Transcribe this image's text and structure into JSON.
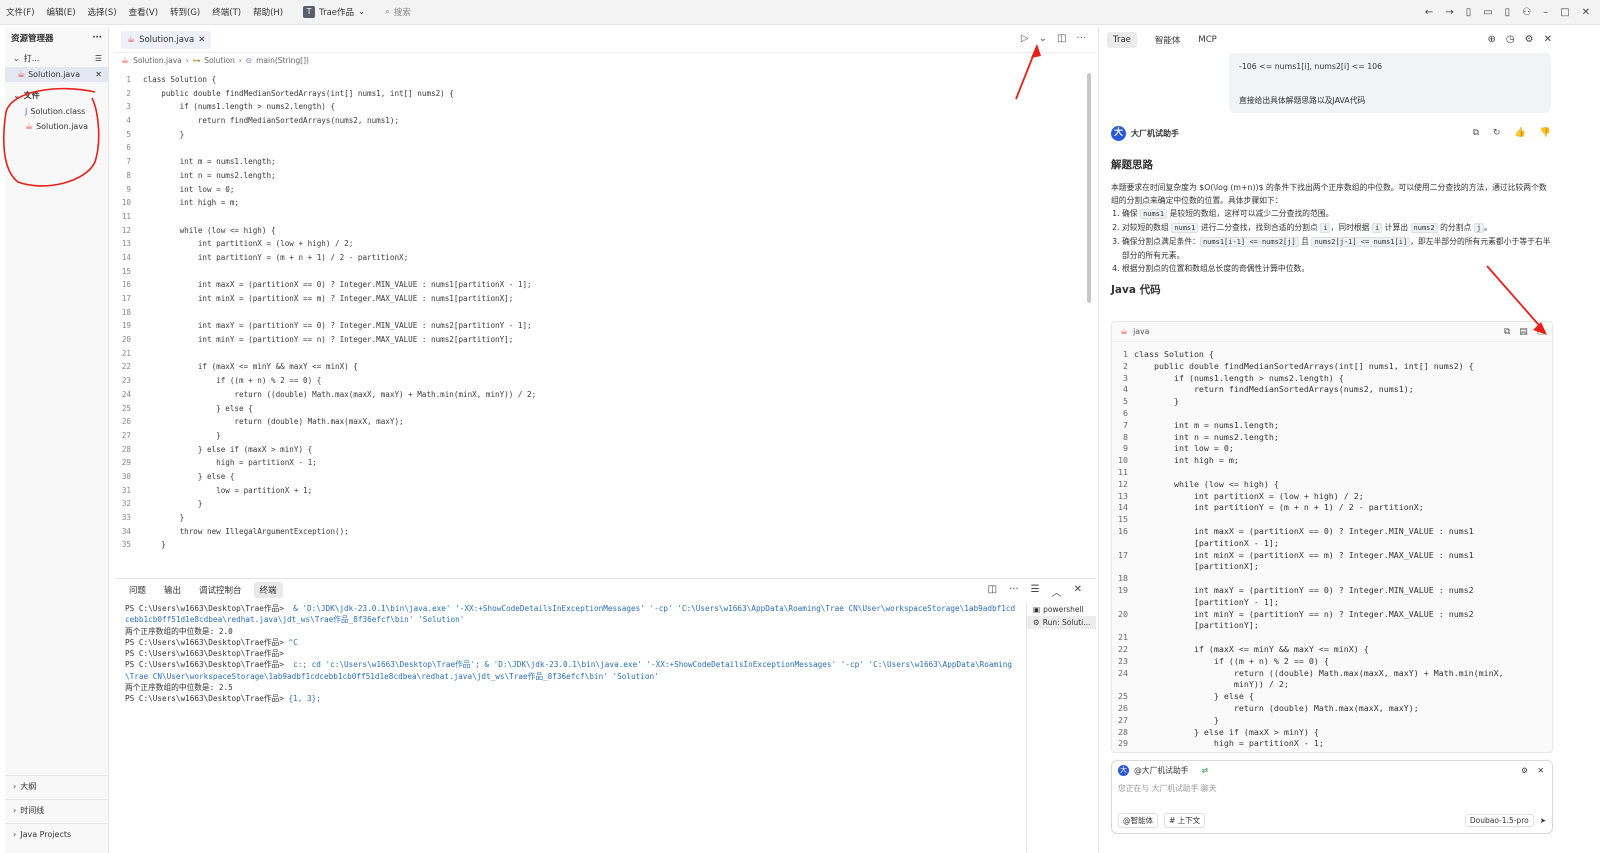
{
  "menubar": {
    "items": [
      "文件(F)",
      "编辑(E)",
      "选择(S)",
      "查看(V)",
      "转到(G)",
      "终端(T)",
      "帮助(H)"
    ],
    "project_icon": "T",
    "project": "Trae作品",
    "search": "搜索"
  },
  "explorer": {
    "title": "资源管理器",
    "open_section": "打...",
    "open_file": "Solution.java",
    "files_section": "文件",
    "files": [
      "Solution.class",
      "Solution.java"
    ],
    "outline": "大纲",
    "timeline": "时间线",
    "java_projects": "Java Projects"
  },
  "editor": {
    "tab": "Solution.java",
    "breadcrumb": [
      "Solution.java",
      "Solution",
      "main(String[])"
    ],
    "lines": [
      "class Solution {",
      "    public double findMedianSortedArrays(int[] nums1, int[] nums2) {",
      "        if (nums1.length > nums2.length) {",
      "            return findMedianSortedArrays(nums2, nums1);",
      "        }",
      "",
      "        int m = nums1.length;",
      "        int n = nums2.length;",
      "        int low = 0;",
      "        int high = m;",
      "",
      "        while (low <= high) {",
      "            int partitionX = (low + high) / 2;",
      "            int partitionY = (m + n + 1) / 2 - partitionX;",
      "",
      "            int maxX = (partitionX == 0) ? Integer.MIN_VALUE : nums1[partitionX - 1];",
      "            int minX = (partitionX == m) ? Integer.MAX_VALUE : nums1[partitionX];",
      "",
      "            int maxY = (partitionY == 0) ? Integer.MIN_VALUE : nums2[partitionY - 1];",
      "            int minY = (partitionY == n) ? Integer.MAX_VALUE : nums2[partitionY];",
      "",
      "            if (maxX <= minY && maxY <= minX) {",
      "                if ((m + n) % 2 == 0) {",
      "                    return ((double) Math.max(maxX, maxY) + Math.min(minX, minY)) / 2;",
      "                } else {",
      "                    return (double) Math.max(maxX, maxY);",
      "                }",
      "            } else if (maxX > minY) {",
      "                high = partitionX - 1;",
      "            } else {",
      "                low = partitionX + 1;",
      "            }",
      "        }",
      "        throw new IllegalArgumentException();",
      "    }"
    ]
  },
  "panel": {
    "tabs": [
      "问题",
      "输出",
      "调试控制台",
      "终端"
    ],
    "active_tab": "终端",
    "terminal": [
      {
        "prompt": "PS C:\\Users\\w1663\\Desktop\\Trae作品> ",
        "cmd": " & 'D:\\JDK\\jdk-23.0.1\\bin\\java.exe' '-XX:+ShowCodeDetailsInExceptionMessages' '-cp' 'C:\\Users\\w1663\\AppData\\Roaming\\Trae CN\\User\\workspaceStorage\\1ab9adbf1cdcebb1cb0ff51d1e8cdbea\\redhat.java\\jdt_ws\\Trae作品_8f36efcf\\bin' 'Solution'"
      },
      {
        "prompt": "两个正序数组的中位数是: 2.0",
        "cmd": ""
      },
      {
        "prompt": "PS C:\\Users\\w1663\\Desktop\\Trae作品> ",
        "cmd": "^C"
      },
      {
        "prompt": "PS C:\\Users\\w1663\\Desktop\\Trae作品>",
        "cmd": ""
      },
      {
        "prompt": "PS C:\\Users\\w1663\\Desktop\\Trae作品> ",
        "cmd": " c:; cd 'c:\\Users\\w1663\\Desktop\\Trae作品'; & 'D:\\JDK\\jdk-23.0.1\\bin\\java.exe' '-XX:+ShowCodeDetailsInExceptionMessages' '-cp' 'C:\\Users\\w1663\\AppData\\Roaming\\Trae CN\\User\\workspaceStorage\\1ab9adbf1cdcebb1cb0ff51d1e8cdbea\\redhat.java\\jdt_ws\\Trae作品_8f36efcf\\bin' 'Solution'"
      },
      {
        "prompt": "两个正序数组的中位数是: 2.5",
        "cmd": ""
      },
      {
        "prompt": "PS C:\\Users\\w1663\\Desktop\\Trae作品> ",
        "cmd": "{1, 3};"
      }
    ],
    "terminals": [
      "powershell",
      "Run: Soluti..."
    ]
  },
  "ai": {
    "tabs": [
      "Trae",
      "智能体",
      "MCP"
    ],
    "user_msg": [
      "-106 <= nums1[i], nums2[i] <= 106",
      "直接给出具体解题思路以及JAVA代码"
    ],
    "assistant_avatar": "大",
    "assistant": "大厂机试助手",
    "h_idea": "解题思路",
    "intro": "本题要求在时间复杂度为 $O(\\log (m+n))$ 的条件下找出两个正序数组的中位数。可以使用二分查找的方法，通过比较两个数组的分割点来确定中位数的位置。具体步骤如下：",
    "steps": [
      {
        "a": "确保 ",
        "c1": "nums1",
        "b": " 是较短的数组，这样可以减少二分查找的范围。"
      },
      {
        "a": "对较短的数组 ",
        "c1": "nums1",
        "b": " 进行二分查找，找到合适的分割点 ",
        "c2": "i",
        "d": "，同时根据 ",
        "c3": "i",
        "e": " 计算出 ",
        "c4": "nums2",
        "f": " 的分割点 ",
        "c5": "j",
        "g": "。"
      },
      {
        "a": "确保分割点满足条件：",
        "c1": "nums1[i-1] <= nums2[j]",
        "b": " 且 ",
        "c2": "nums2[j-1] <= nums1[i]",
        "d": "，即左半部分的所有元素都小于等于右半部分的所有元素。"
      },
      {
        "a": "根据分割点的位置和数组总长度的奇偶性计算中位数。"
      }
    ],
    "h_code": "Java 代码",
    "code_lang": "java",
    "code": [
      [
        "1",
        "class Solution {"
      ],
      [
        "2",
        "    public double findMedianSortedArrays(int[] nums1, int[] nums2) {"
      ],
      [
        "3",
        "        if (nums1.length > nums2.length) {"
      ],
      [
        "4",
        "            return findMedianSortedArrays(nums2, nums1);"
      ],
      [
        "5",
        "        }"
      ],
      [
        "6",
        ""
      ],
      [
        "7",
        "        int m = nums1.length;"
      ],
      [
        "8",
        "        int n = nums2.length;"
      ],
      [
        "9",
        "        int low = 0;"
      ],
      [
        "10",
        "        int high = m;"
      ],
      [
        "11",
        ""
      ],
      [
        "12",
        "        while (low <= high) {"
      ],
      [
        "13",
        "            int partitionX = (low + high) / 2;"
      ],
      [
        "14",
        "            int partitionY = (m + n + 1) / 2 - partitionX;"
      ],
      [
        "15",
        ""
      ],
      [
        "16",
        "            int maxX = (partitionX == 0) ? Integer.MIN_VALUE : nums1"
      ],
      [
        "",
        "            [partitionX - 1];"
      ],
      [
        "17",
        "            int minX = (partitionX == m) ? Integer.MAX_VALUE : nums1"
      ],
      [
        "",
        "            [partitionX];"
      ],
      [
        "18",
        ""
      ],
      [
        "19",
        "            int maxY = (partitionY == 0) ? Integer.MIN_VALUE : nums2"
      ],
      [
        "",
        "            [partitionY - 1];"
      ],
      [
        "20",
        "            int minY = (partitionY == n) ? Integer.MAX_VALUE : nums2"
      ],
      [
        "",
        "            [partitionY];"
      ],
      [
        "21",
        ""
      ],
      [
        "22",
        "            if (maxX <= minY && maxY <= minX) {"
      ],
      [
        "23",
        "                if ((m + n) % 2 == 0) {"
      ],
      [
        "24",
        "                    return ((double) Math.max(maxX, maxY) + Math.min(minX,"
      ],
      [
        "",
        "                    minY)) / 2;"
      ],
      [
        "25",
        "                } else {"
      ],
      [
        "26",
        "                    return (double) Math.max(maxX, maxY);"
      ],
      [
        "27",
        "                }"
      ],
      [
        "28",
        "            } else if (maxX > minY) {"
      ],
      [
        "29",
        "                high = partitionX - 1;"
      ]
    ],
    "input_mention": "@大厂机试助手",
    "input_placeholder": "您正在与 大厂机试助手 聊天",
    "chip_agent": "@智能体",
    "chip_context": "# 上下文",
    "model": "Doubao-1.5-pro"
  },
  "colors": {
    "annotation": "#e8201a",
    "accent": "#2958d8"
  }
}
